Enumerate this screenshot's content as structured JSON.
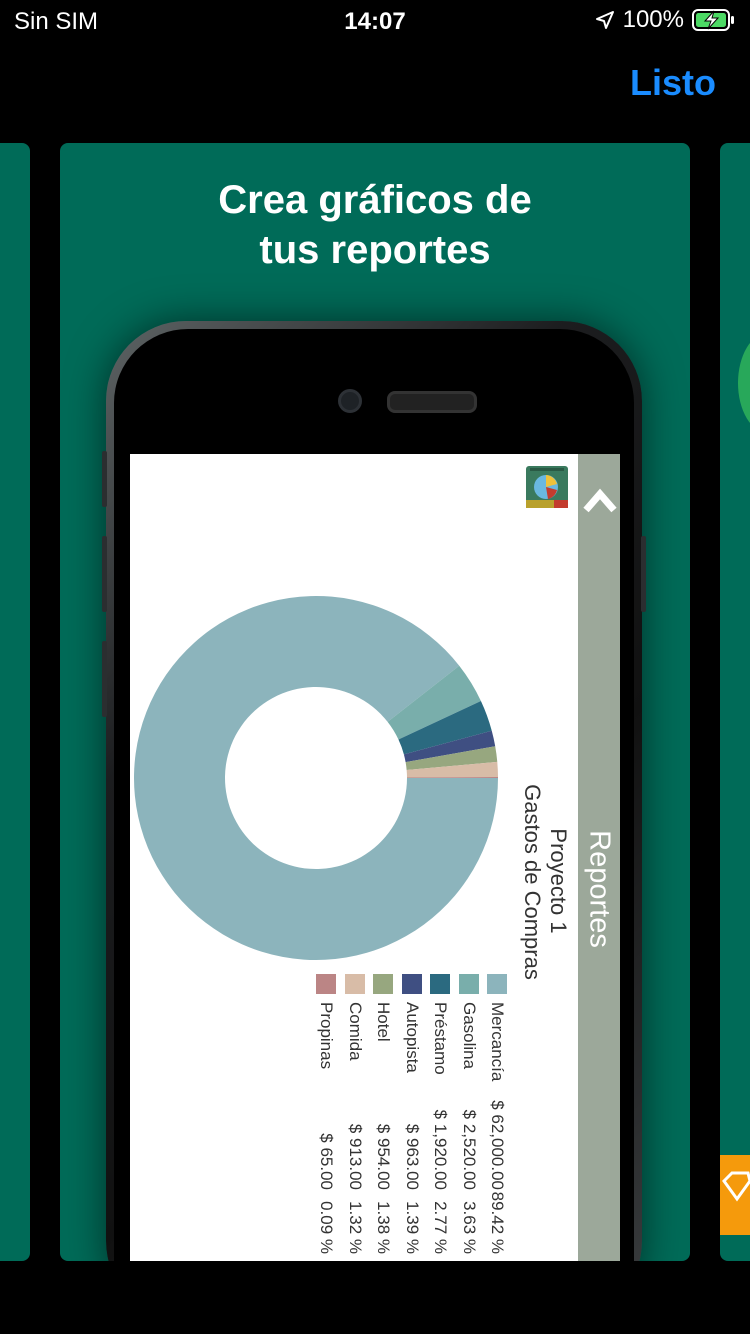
{
  "status_bar": {
    "carrier": "Sin SIM",
    "time": "14:07",
    "battery": "100%"
  },
  "nav": {
    "done_label": "Listo"
  },
  "card": {
    "headline_line1": "Crea gráficos de",
    "headline_line2": "tus reportes"
  },
  "inner_app": {
    "header_title": "Reportes",
    "project": "Proyecto 1",
    "report_name": "Gastos de Compras"
  },
  "colors": {
    "card_bg": "#006b58",
    "accent_blue": "#1a8cff",
    "report_bar": "#9ca89a"
  },
  "chart_data": {
    "type": "pie",
    "subtype": "donut",
    "series": [
      {
        "name": "Mercancía",
        "amount": "$ 62,000.00",
        "percent": "89.42 %",
        "value": 89.42,
        "color": "#8cb4bc"
      },
      {
        "name": "Gasolina",
        "amount": "$ 2,520.00",
        "percent": "3.63 %",
        "value": 3.63,
        "color": "#79aeab"
      },
      {
        "name": "Préstamo",
        "amount": "$ 1,920.00",
        "percent": "2.77 %",
        "value": 2.77,
        "color": "#2b6a80"
      },
      {
        "name": "Autopista",
        "amount": "$ 963.00",
        "percent": "1.39 %",
        "value": 1.39,
        "color": "#3f4f82"
      },
      {
        "name": "Hotel",
        "amount": "$ 954.00",
        "percent": "1.38 %",
        "value": 1.38,
        "color": "#97a77f"
      },
      {
        "name": "Comida",
        "amount": "$ 913.00",
        "percent": "1.32 %",
        "value": 1.32,
        "color": "#d8bca7"
      },
      {
        "name": "Propinas",
        "amount": "$ 65.00",
        "percent": "0.09 %",
        "value": 0.09,
        "color": "#bb8585"
      }
    ]
  }
}
